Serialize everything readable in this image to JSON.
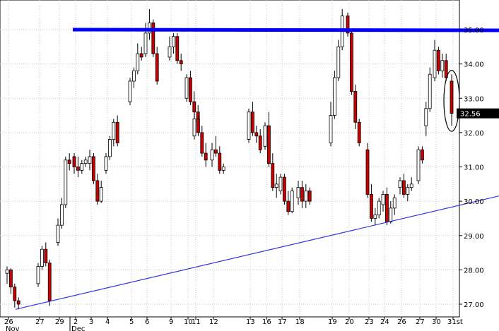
{
  "chart_data": {
    "type": "candlestick",
    "ylim": [
      26.8,
      35.7
    ],
    "yticks": [
      "27.00",
      "28.00",
      "29.00",
      "30.00",
      "31.00",
      "32.00",
      "33.00",
      "34.00",
      "35.00"
    ],
    "last_price": "32.56",
    "grid": true,
    "legend": "none",
    "colors": {
      "up": "#ffffff",
      "down": "#cc0000",
      "horizontal": "#0000ff",
      "trendline": "#3333dd",
      "grid": "#c8c8c8"
    },
    "day_labels": [
      "26",
      "27",
      "29",
      "2",
      "3",
      "4",
      "5",
      "6",
      "9",
      "10",
      "11",
      "12",
      "13",
      "16",
      "17",
      "18",
      "19",
      "20",
      "23",
      "24",
      "26",
      "27",
      "30",
      "31st"
    ],
    "month_labels": [
      "Nov",
      "Dec"
    ],
    "horizontal_line": {
      "y": 35.0,
      "from_day": "2"
    },
    "trendline": {
      "from": {
        "day": "27",
        "y": 26.85
      },
      "to": {
        "day": "31st",
        "y": 30.05
      }
    },
    "annotation": {
      "type": "ellipse",
      "day": "30",
      "y_range": [
        32.1,
        33.75
      ]
    },
    "days": [
      {
        "label": "26",
        "bars": [
          [
            27.9,
            28.1,
            27.6,
            28.0
          ],
          [
            28.0,
            28.05,
            27.3,
            27.5
          ],
          [
            27.5,
            27.6,
            26.9,
            27.1
          ],
          [
            27.1,
            27.2,
            26.85,
            27.0
          ]
        ]
      },
      {
        "label": "27",
        "bars": [
          [
            27.6,
            28.2,
            27.5,
            28.1
          ],
          [
            28.1,
            28.7,
            28.0,
            28.6
          ],
          [
            28.6,
            28.8,
            28.1,
            28.2
          ],
          [
            28.2,
            28.3,
            26.95,
            27.1
          ]
        ]
      },
      {
        "label": "29",
        "bars": [
          [
            28.8,
            29.5,
            28.7,
            29.3
          ],
          [
            29.3,
            30.1,
            29.2,
            29.9
          ],
          [
            29.9,
            31.3,
            29.8,
            31.2
          ],
          [
            31.2,
            31.4,
            30.9,
            31.1
          ]
        ]
      },
      {
        "label": "2",
        "bars": [
          [
            31.3,
            31.4,
            30.8,
            31.0
          ],
          [
            31.0,
            31.3,
            30.7,
            30.9
          ],
          [
            30.9,
            31.2,
            30.8,
            31.1
          ],
          [
            31.1,
            31.3,
            31.0,
            31.2
          ]
        ]
      },
      {
        "label": "3",
        "bars": [
          [
            31.1,
            31.5,
            30.9,
            31.3
          ],
          [
            31.3,
            31.4,
            30.5,
            30.6
          ],
          [
            30.6,
            30.8,
            29.9,
            30.0
          ],
          [
            30.0,
            30.6,
            29.95,
            30.4
          ]
        ]
      },
      {
        "label": "4",
        "bars": [
          [
            30.9,
            31.4,
            30.8,
            31.3
          ],
          [
            31.3,
            31.9,
            31.2,
            31.8
          ],
          [
            31.8,
            32.4,
            31.6,
            32.3
          ],
          [
            32.3,
            32.5,
            31.6,
            31.7
          ]
        ]
      },
      {
        "label": "5",
        "bars": [
          [
            32.9,
            33.6,
            32.8,
            33.5
          ],
          [
            33.5,
            33.9,
            33.3,
            33.8
          ],
          [
            33.8,
            34.6,
            33.7,
            34.3
          ],
          [
            34.3,
            34.5,
            34.1,
            34.2
          ]
        ]
      },
      {
        "label": "6",
        "bars": [
          [
            34.3,
            35.2,
            34.2,
            34.9
          ],
          [
            34.9,
            35.6,
            34.7,
            35.2
          ],
          [
            35.2,
            35.3,
            34.2,
            34.3
          ],
          [
            34.3,
            34.5,
            33.4,
            33.5
          ]
        ]
      },
      {
        "label": "9",
        "bars": [
          [
            34.2,
            34.8,
            34.1,
            34.5
          ],
          [
            34.5,
            34.9,
            34.3,
            34.8
          ],
          [
            34.8,
            34.9,
            34.0,
            34.1
          ],
          [
            34.1,
            34.3,
            33.8,
            34.0
          ]
        ]
      },
      {
        "label": "10",
        "bars": [
          [
            33.0,
            33.7,
            32.9,
            33.6
          ],
          [
            33.6,
            33.8,
            32.8,
            32.9
          ],
          [
            32.9,
            33.2,
            32.4,
            32.6
          ],
          [
            32.6,
            32.8,
            32.2,
            32.3
          ]
        ]
      },
      {
        "label": "11",
        "bars": [
          [
            31.9,
            32.6,
            31.8,
            32.4
          ],
          [
            32.4,
            32.5,
            31.9,
            32.0
          ],
          [
            32.0,
            32.2,
            31.3,
            31.4
          ],
          [
            31.4,
            31.7,
            31.0,
            31.2
          ]
        ]
      },
      {
        "label": "12",
        "bars": [
          [
            31.2,
            31.7,
            31.0,
            31.5
          ],
          [
            31.5,
            31.9,
            31.3,
            31.4
          ],
          [
            31.4,
            31.6,
            30.8,
            30.9
          ],
          [
            30.9,
            31.1,
            30.8,
            31.0
          ]
        ]
      },
      {
        "label": "13",
        "bars": [
          [
            31.8,
            32.7,
            31.7,
            32.6
          ],
          [
            32.6,
            32.9,
            31.9,
            32.0
          ],
          [
            32.0,
            32.2,
            31.7,
            31.9
          ],
          [
            31.9,
            32.1,
            31.4,
            31.5
          ]
        ]
      },
      {
        "label": "16",
        "bars": [
          [
            31.6,
            32.3,
            31.5,
            32.2
          ],
          [
            32.2,
            32.6,
            31.0,
            31.1
          ],
          [
            31.1,
            31.4,
            30.3,
            30.4
          ],
          [
            30.4,
            30.8,
            30.1,
            30.5
          ]
        ]
      },
      {
        "label": "17",
        "bars": [
          [
            30.3,
            30.8,
            30.2,
            30.7
          ],
          [
            30.7,
            30.8,
            29.9,
            30.0
          ],
          [
            30.0,
            30.3,
            29.6,
            29.7
          ],
          [
            29.7,
            30.4,
            29.65,
            30.3
          ]
        ]
      },
      {
        "label": "18",
        "bars": [
          [
            30.1,
            30.6,
            29.9,
            30.4
          ],
          [
            30.4,
            30.6,
            29.8,
            30.0
          ],
          [
            30.0,
            30.5,
            29.8,
            30.3
          ],
          [
            30.3,
            30.4,
            29.9,
            30.0
          ]
        ]
      },
      {
        "label": "19",
        "bars": [
          [
            31.7,
            32.9,
            31.6,
            32.5
          ],
          [
            32.5,
            33.8,
            32.4,
            33.6
          ],
          [
            33.6,
            34.7,
            33.5,
            34.5
          ],
          [
            34.5,
            35.6,
            34.4,
            35.4
          ]
        ]
      },
      {
        "label": "20",
        "bars": [
          [
            35.4,
            35.5,
            34.8,
            34.9
          ],
          [
            34.9,
            35.0,
            33.1,
            33.2
          ],
          [
            33.2,
            33.4,
            32.1,
            32.3
          ],
          [
            32.3,
            32.4,
            31.6,
            31.7
          ]
        ]
      },
      {
        "label": "23",
        "bars": [
          [
            31.5,
            31.7,
            30.1,
            30.2
          ],
          [
            30.2,
            30.5,
            29.4,
            29.5
          ],
          [
            29.5,
            29.8,
            29.3,
            29.6
          ],
          [
            29.6,
            30.1,
            29.5,
            30.0
          ]
        ]
      },
      {
        "label": "24",
        "bars": [
          [
            29.9,
            30.3,
            29.7,
            30.2
          ],
          [
            30.2,
            30.4,
            29.3,
            29.4
          ],
          [
            29.4,
            30.0,
            29.35,
            29.8
          ],
          [
            29.8,
            30.2,
            29.6,
            30.1
          ]
        ]
      },
      {
        "label": "26",
        "bars": [
          [
            30.4,
            30.7,
            30.2,
            30.6
          ],
          [
            30.6,
            30.8,
            30.1,
            30.2
          ],
          [
            30.2,
            30.5,
            30.0,
            30.4
          ],
          [
            30.4,
            30.7,
            30.3,
            30.5
          ]
        ]
      },
      {
        "label": "27",
        "bars": [
          [
            30.6,
            31.6,
            30.5,
            31.5
          ],
          [
            31.5,
            31.6,
            31.1,
            31.2
          ],
          [
            32.2,
            32.9,
            31.9,
            32.7
          ],
          [
            32.7,
            33.9,
            32.6,
            33.7
          ]
        ]
      },
      {
        "label": "30",
        "bars": [
          [
            33.6,
            34.7,
            33.5,
            34.4
          ],
          [
            34.4,
            34.5,
            33.7,
            33.8
          ],
          [
            33.8,
            34.3,
            33.6,
            34.1
          ],
          [
            34.1,
            34.3,
            33.5,
            33.6
          ]
        ]
      },
      {
        "label": "31st",
        "bars": [
          [
            33.5,
            33.7,
            32.2,
            32.56
          ]
        ]
      }
    ]
  }
}
